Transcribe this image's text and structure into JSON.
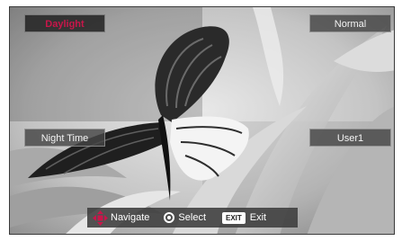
{
  "picture_modes": {
    "daylight": "Daylight",
    "normal": "Normal",
    "night_time": "Night Time",
    "user1": "User1",
    "active": "daylight"
  },
  "nav_bar": {
    "navigate_label": "Navigate",
    "select_label": "Select",
    "exit_key": "EXIT",
    "exit_label": "Exit"
  },
  "colors": {
    "active_text": "#c8164a",
    "dpad": "#c8164a"
  },
  "icons": {
    "navigate": "dpad-icon",
    "select": "select-icon",
    "exit": "exit-key-icon"
  }
}
